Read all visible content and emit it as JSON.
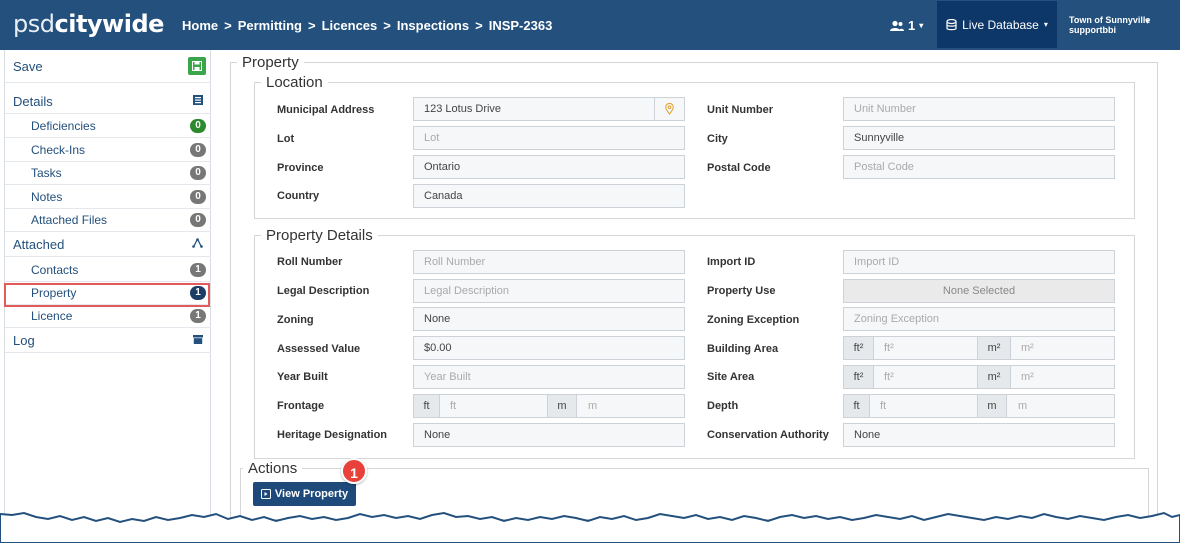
{
  "header": {
    "logo_thin": "psd",
    "logo_bold": "citywide",
    "breadcrumbs": [
      "Home",
      "Permitting",
      "Licences",
      "Inspections",
      "INSP-2363"
    ],
    "user_count": "1",
    "database_label": "Live Database",
    "town": "Town of Sunnyville",
    "user": "supportbbi"
  },
  "sidebar": {
    "save": "Save",
    "details": "Details",
    "deficiencies": {
      "label": "Deficiencies",
      "count": "0"
    },
    "checkins": {
      "label": "Check-Ins",
      "count": "0"
    },
    "tasks": {
      "label": "Tasks",
      "count": "0"
    },
    "notes": {
      "label": "Notes",
      "count": "0"
    },
    "attached_files": {
      "label": "Attached Files",
      "count": "0"
    },
    "attached": "Attached",
    "contacts": {
      "label": "Contacts",
      "count": "1"
    },
    "property": {
      "label": "Property",
      "count": "1"
    },
    "licence": {
      "label": "Licence",
      "count": "1"
    },
    "log": "Log"
  },
  "property_section": {
    "title": "Property",
    "location": {
      "title": "Location",
      "municipal_address": {
        "label": "Municipal Address",
        "value": "123 Lotus Drive"
      },
      "unit_number": {
        "label": "Unit Number",
        "placeholder": "Unit Number"
      },
      "lot": {
        "label": "Lot",
        "placeholder": "Lot"
      },
      "city": {
        "label": "City",
        "value": "Sunnyville"
      },
      "province": {
        "label": "Province",
        "value": "Ontario"
      },
      "postal_code": {
        "label": "Postal Code",
        "placeholder": "Postal Code"
      },
      "country": {
        "label": "Country",
        "value": "Canada"
      }
    },
    "details": {
      "title": "Property Details",
      "roll_number": {
        "label": "Roll Number",
        "placeholder": "Roll Number"
      },
      "import_id": {
        "label": "Import ID",
        "placeholder": "Import ID"
      },
      "legal_description": {
        "label": "Legal Description",
        "placeholder": "Legal Description"
      },
      "property_use": {
        "label": "Property Use",
        "value": "None Selected"
      },
      "zoning": {
        "label": "Zoning",
        "value": "None"
      },
      "zoning_exception": {
        "label": "Zoning Exception",
        "placeholder": "Zoning Exception"
      },
      "assessed_value": {
        "label": "Assessed Value",
        "value": "$0.00"
      },
      "building_area": {
        "label": "Building Area",
        "unit1": "ft²",
        "ph1": "ft²",
        "unit2": "m²",
        "ph2": "m²"
      },
      "year_built": {
        "label": "Year Built",
        "placeholder": "Year Built"
      },
      "site_area": {
        "label": "Site Area",
        "unit1": "ft²",
        "ph1": "ft²",
        "unit2": "m²",
        "ph2": "m²"
      },
      "frontage": {
        "label": "Frontage",
        "unit1": "ft",
        "ph1": "ft",
        "unit2": "m",
        "ph2": "m"
      },
      "depth": {
        "label": "Depth",
        "unit1": "ft",
        "ph1": "ft",
        "unit2": "m",
        "ph2": "m"
      },
      "heritage_designation": {
        "label": "Heritage Designation",
        "value": "None"
      },
      "conservation_authority": {
        "label": "Conservation Authority",
        "value": "None"
      }
    }
  },
  "actions": {
    "title": "Actions",
    "view_property": "View Property",
    "callout_number": "1"
  },
  "colors": {
    "header": "#23507c",
    "live_db": "#0d3768",
    "button": "#1d4a7a",
    "highlight": "#e35a5a",
    "callout": "#e8403a"
  }
}
